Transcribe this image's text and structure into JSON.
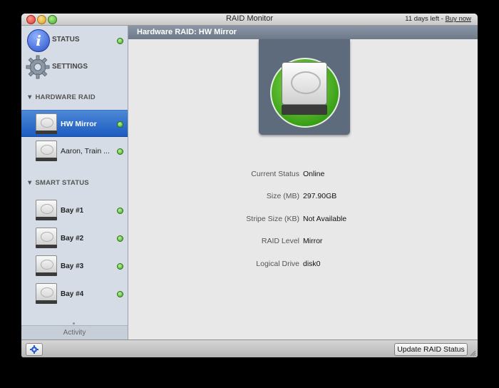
{
  "window": {
    "title": "RAID Monitor",
    "trial_text": "11 days left - ",
    "buy_link": "Buy now"
  },
  "sidebar": {
    "status_label": "STATUS",
    "settings_label": "SETTINGS",
    "hardware_raid_header": "▼ HARDWARE RAID",
    "hardware_items": [
      {
        "label": "HW Mirror",
        "selected": true
      },
      {
        "label": "Aaron, Train ..."
      }
    ],
    "smart_header": "▼ SMART STATUS",
    "smart_items": [
      {
        "label": "Bay #1"
      },
      {
        "label": "Bay #2"
      },
      {
        "label": "Bay #3"
      },
      {
        "label": "Bay #4"
      }
    ],
    "activity_label": "Activity"
  },
  "main": {
    "header": "Hardware RAID: HW Mirror",
    "properties": [
      {
        "label": "Current Status",
        "value": "Online"
      },
      {
        "label": "Size (MB)",
        "value": "297.90GB"
      },
      {
        "label": "Stripe Size (KB)",
        "value": "Not Available"
      },
      {
        "label": "RAID Level",
        "value": "Mirror"
      },
      {
        "label": "Logical Drive",
        "value": "disk0"
      }
    ]
  },
  "bottom": {
    "update_button": "Update RAID Status"
  },
  "colors": {
    "selection": "#2a68c8",
    "status_ok": "#3da220",
    "hero_panel": "#5e6b7c"
  }
}
